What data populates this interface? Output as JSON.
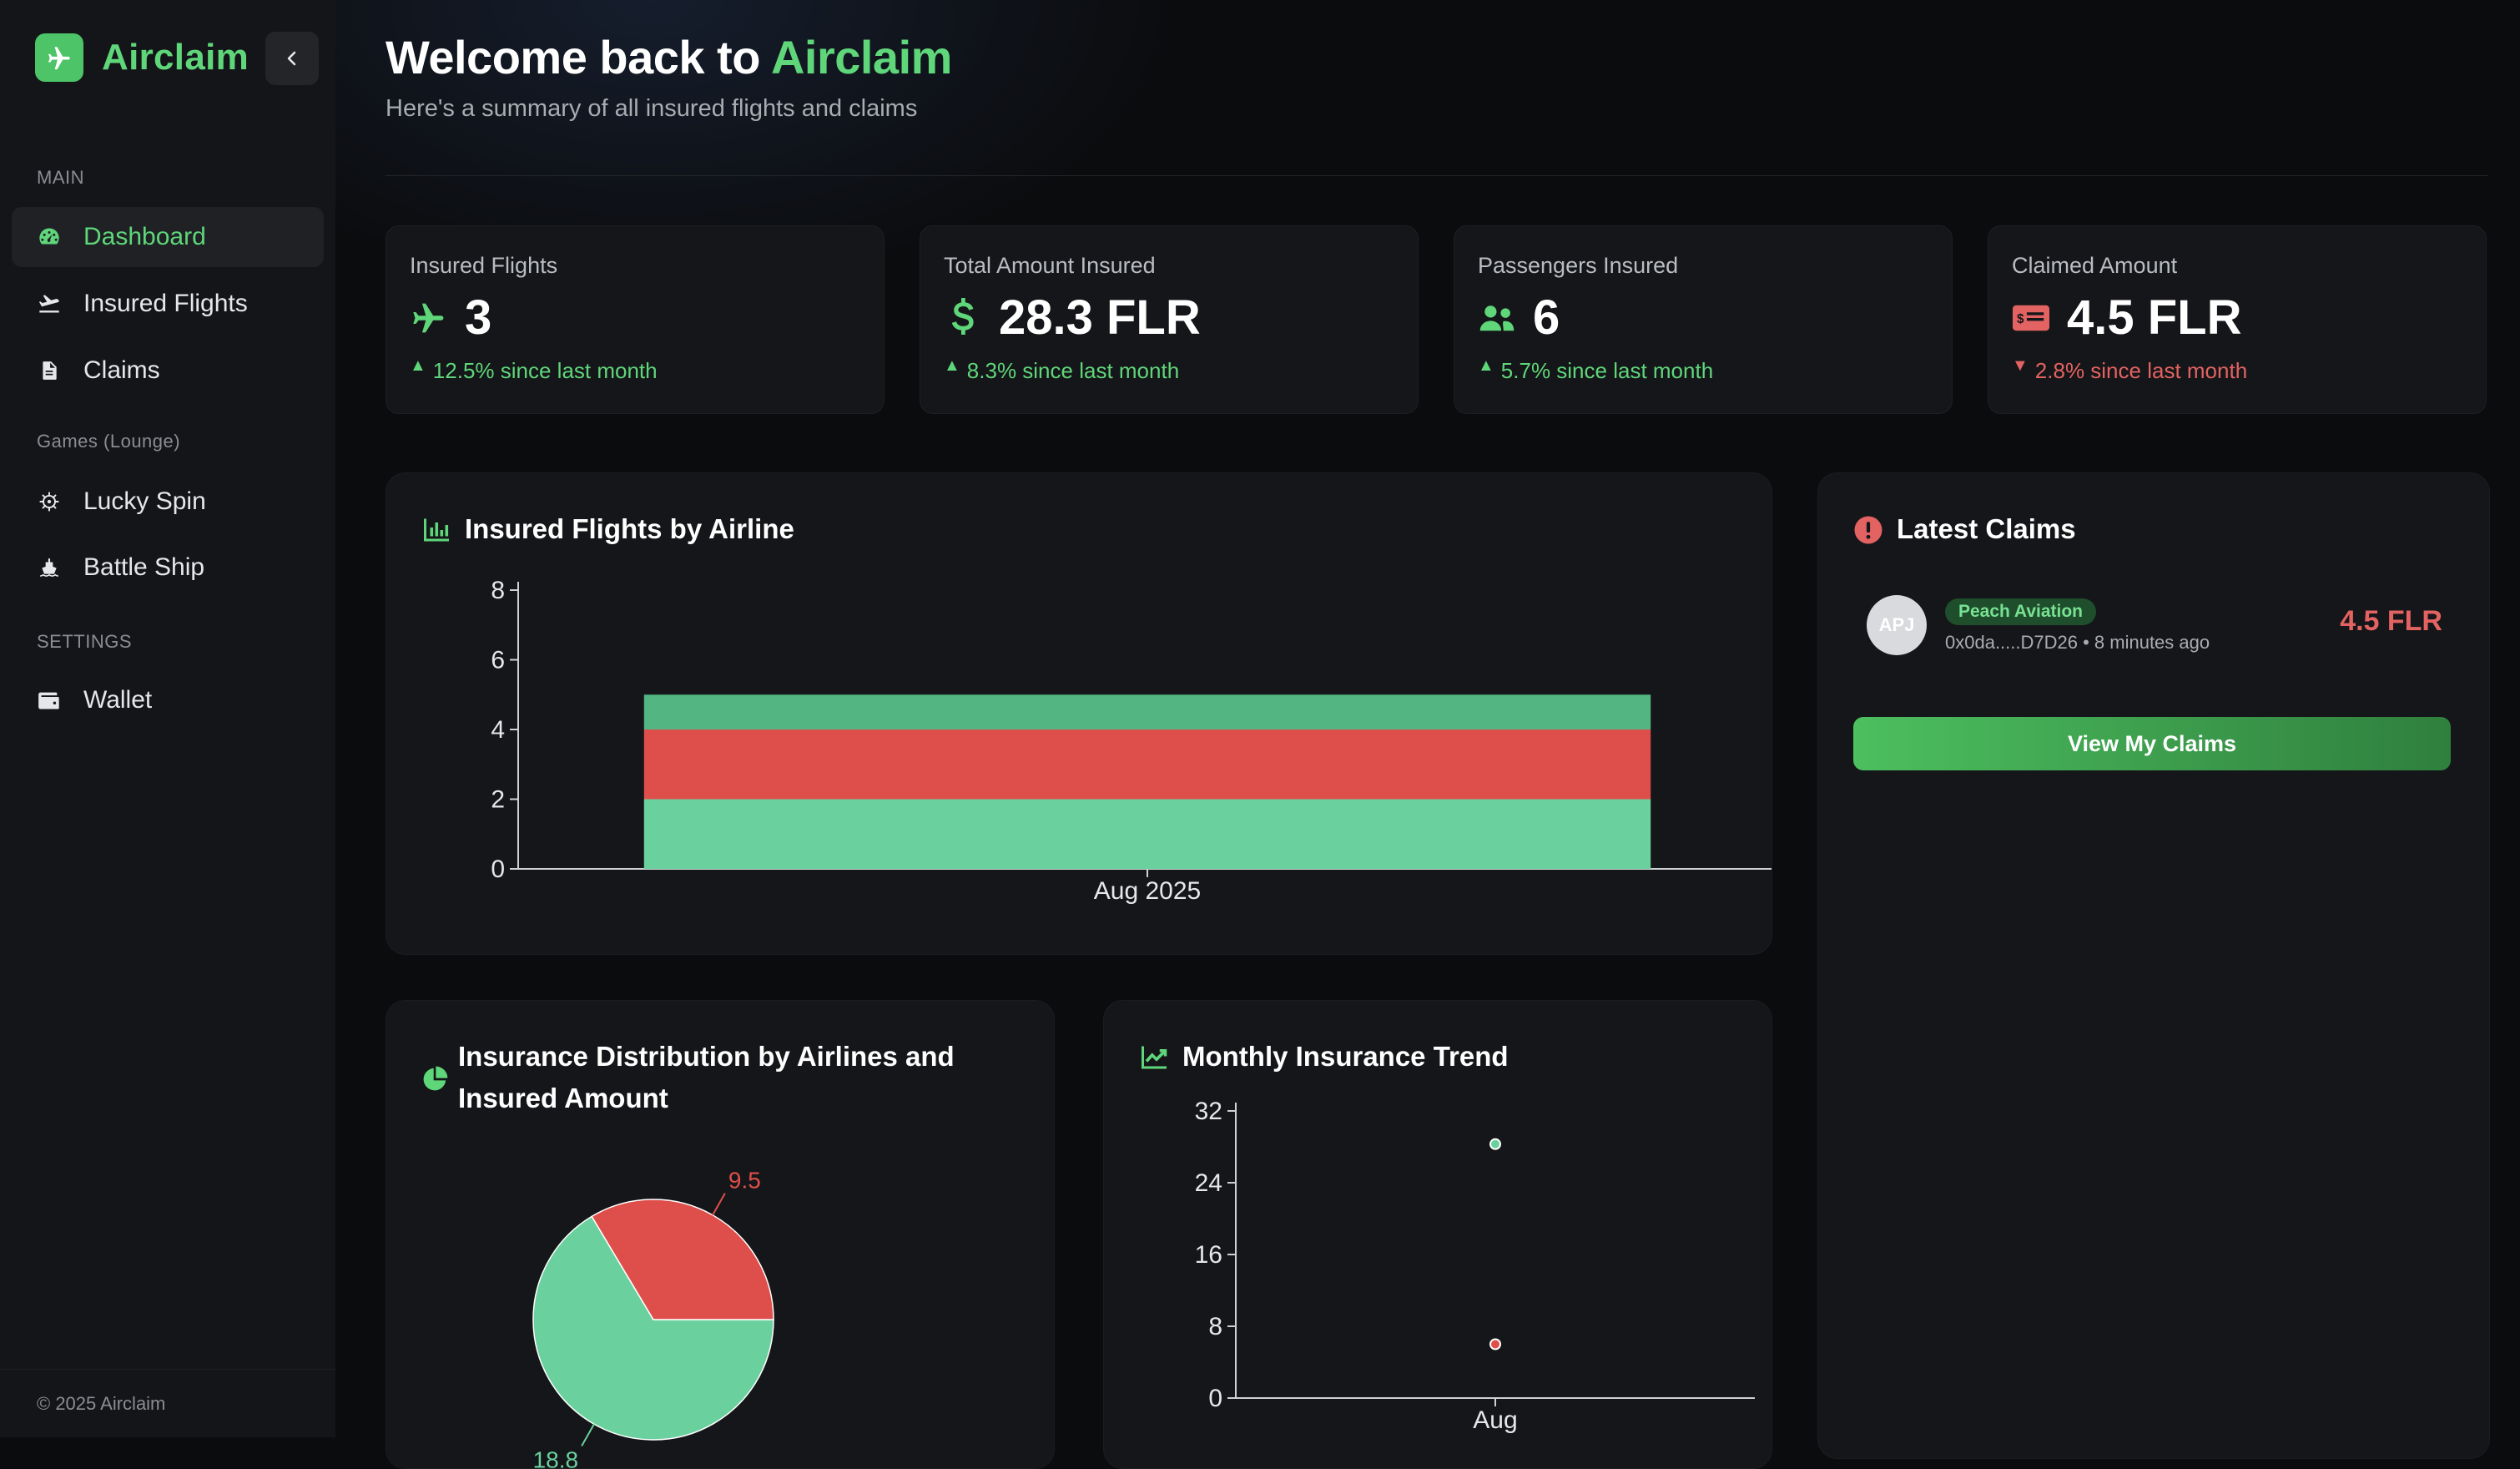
{
  "sidebar": {
    "brand": "Airclaim",
    "sections": [
      {
        "title": "MAIN"
      },
      {
        "title": "Games (Lounge)"
      },
      {
        "title": "SETTINGS"
      }
    ],
    "items": [
      {
        "label": "Dashboard",
        "icon": "gauge-icon",
        "active": true
      },
      {
        "label": "Insured Flights",
        "icon": "plane-departure-icon"
      },
      {
        "label": "Claims",
        "icon": "document-icon"
      },
      {
        "label": "Lucky Spin",
        "icon": "ship-wheel-icon"
      },
      {
        "label": "Battle Ship",
        "icon": "ship-icon"
      },
      {
        "label": "Wallet",
        "icon": "wallet-icon"
      }
    ],
    "copyright": "© 2025 Airclaim"
  },
  "header": {
    "welcome_prefix": "Welcome back to ",
    "welcome_brand": "Airclaim",
    "subtitle": "Here's a summary of all insured flights and claims"
  },
  "stats": [
    {
      "label": "Insured Flights",
      "value": "3",
      "change": "12.5% since last month",
      "trend": "up",
      "icon": "plane-icon"
    },
    {
      "label": "Total Amount Insured",
      "value": "28.3 FLR",
      "change": "8.3% since last month",
      "trend": "up",
      "icon": "dollar-icon"
    },
    {
      "label": "Passengers Insured",
      "value": "6",
      "change": "5.7% since last month",
      "trend": "up",
      "icon": "users-icon"
    },
    {
      "label": "Claimed Amount",
      "value": "4.5 FLR",
      "change": "2.8% since last month",
      "trend": "down",
      "icon": "ticket-icon"
    }
  ],
  "cards": {
    "airline_chart_title": "Insured Flights by Airline",
    "distribution_title_line1": "Insurance Distribution by Airlines and",
    "distribution_title_line2": "Insured Amount",
    "trend_title": "Monthly Insurance Trend",
    "latest_claims_title": "Latest Claims"
  },
  "latest_claims": {
    "items": [
      {
        "initials": "APJ",
        "airline": "Peach Aviation",
        "meta": "0x0da.....D7D26 • 8 minutes ago",
        "amount": "4.5 FLR"
      }
    ],
    "button": "View My Claims"
  },
  "colors": {
    "accent": "#5fd67a",
    "green_series": "#6ad19e",
    "green_series_dark": "#52b582",
    "red_series": "#de4f4b"
  },
  "chart_data": [
    {
      "type": "bar",
      "stacked": true,
      "categories": [
        "Aug 2025"
      ],
      "series": [
        {
          "values": [
            2
          ]
        },
        {
          "values": [
            2
          ]
        },
        {
          "values": [
            1
          ]
        }
      ],
      "ylim": [
        0,
        8
      ],
      "yticks": [
        0,
        2,
        4,
        6,
        8
      ]
    },
    {
      "type": "pie",
      "slices": [
        {
          "label": "18.8",
          "value": 18.8
        },
        {
          "label": "9.5",
          "value": 9.5
        }
      ]
    },
    {
      "type": "scatter",
      "categories": [
        "Aug"
      ],
      "series": [
        {
          "values": [
            28.3
          ]
        },
        {
          "values": [
            6
          ]
        }
      ],
      "ylim": [
        0,
        32
      ],
      "yticks": [
        0,
        8,
        16,
        24,
        32
      ]
    }
  ]
}
